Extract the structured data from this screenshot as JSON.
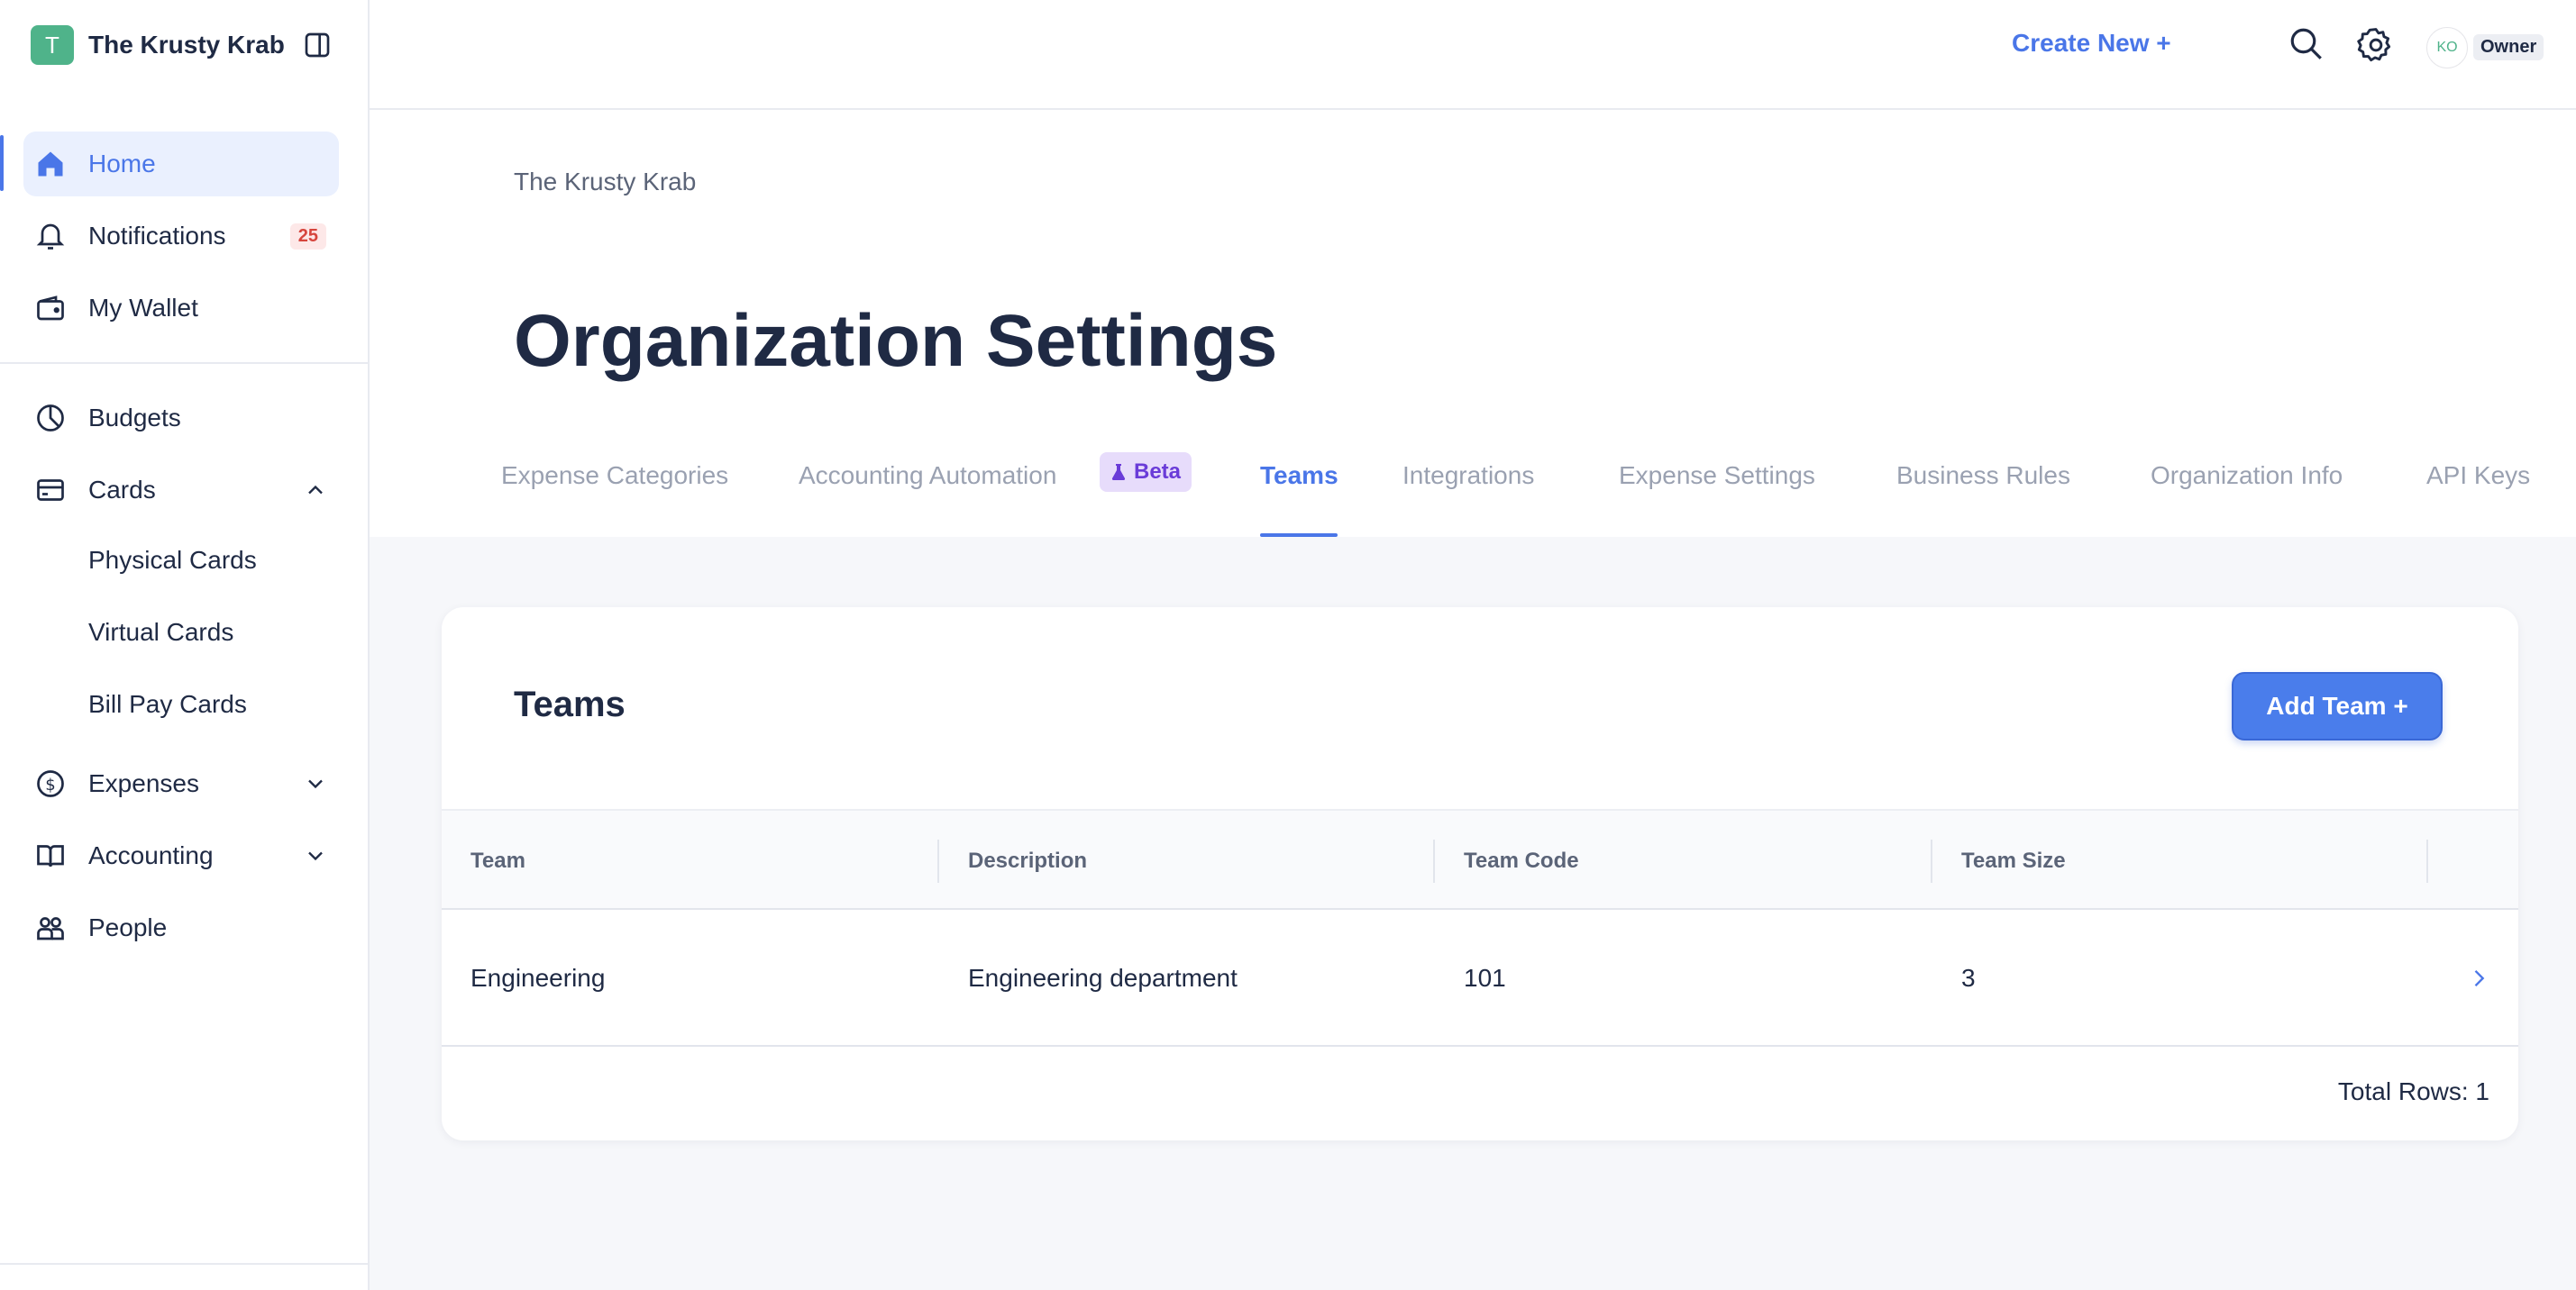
{
  "brand": {
    "initial": "T",
    "name": "The Krusty Krab"
  },
  "sidebar": {
    "items": [
      {
        "label": "Home"
      },
      {
        "label": "Notifications",
        "badge": "25"
      },
      {
        "label": "My Wallet"
      },
      {
        "label": "Budgets"
      },
      {
        "label": "Cards"
      },
      {
        "label": "Expenses"
      },
      {
        "label": "Accounting"
      },
      {
        "label": "People"
      }
    ],
    "card_subitems": [
      "Physical Cards",
      "Virtual Cards",
      "Bill Pay Cards"
    ]
  },
  "topbar": {
    "create_new": "Create New +",
    "avatar_initials": "KO",
    "role": "Owner"
  },
  "header": {
    "breadcrumb": "The Krusty Krab",
    "title": "Organization Settings",
    "tabs": [
      "Expense Categories",
      "Accounting Automation",
      "Teams",
      "Integrations",
      "Expense Settings",
      "Business Rules",
      "Organization Info",
      "API Keys"
    ],
    "active_tab": "Teams",
    "beta_label": "Beta"
  },
  "teams_card": {
    "title": "Teams",
    "add_button": "Add Team +",
    "columns": [
      "Team",
      "Description",
      "Team Code",
      "Team Size"
    ],
    "rows": [
      {
        "team": "Engineering",
        "description": "Engineering department",
        "code": "101",
        "size": "3"
      }
    ],
    "total_rows": "Total Rows: 1"
  },
  "colors": {
    "accent": "#4a76e8",
    "brand_green": "#4fb38a",
    "badge_red": "#d6453d",
    "beta_purple": "#6a3cd8"
  }
}
